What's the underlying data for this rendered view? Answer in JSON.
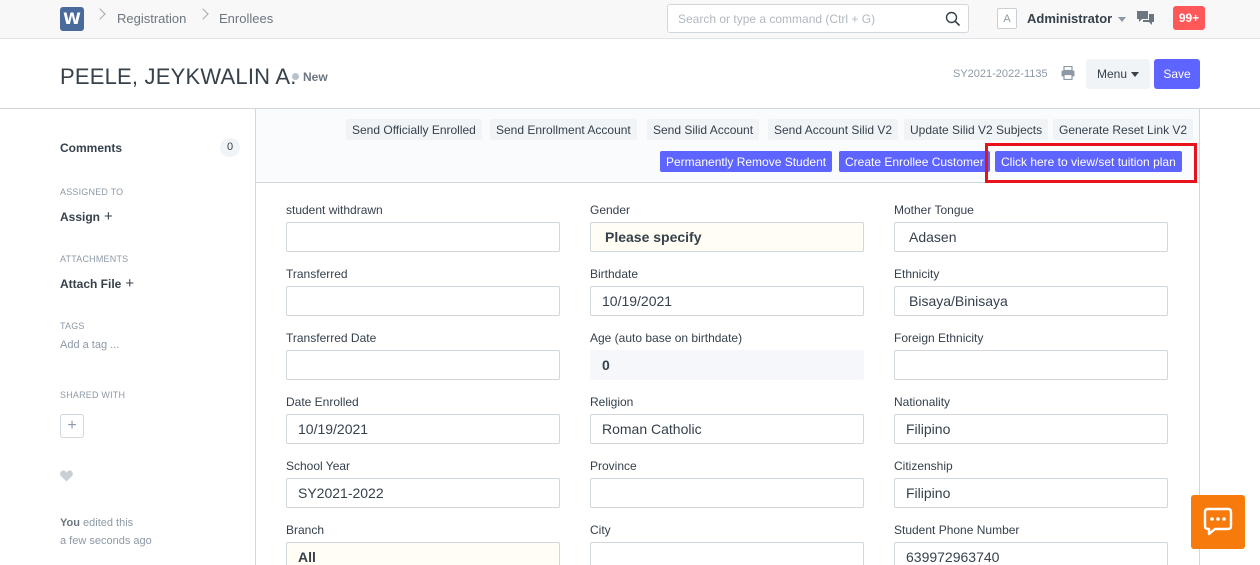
{
  "navbar": {
    "logo": "W",
    "breadcrumbs": [
      "Registration",
      "Enrollees"
    ],
    "search_placeholder": "Search or type a command (Ctrl + G)",
    "avatar_letter": "A",
    "user": "Administrator",
    "notifications": "99+"
  },
  "page": {
    "title": "PEELE, JEYKWALIN A.",
    "status": "New",
    "doc_name": "SY2021-2022-1135",
    "menu_label": "Menu",
    "save_label": "Save"
  },
  "sidebar": {
    "comments_label": "Comments",
    "comments_count": "0",
    "assigned_to_label": "ASSIGNED TO",
    "assign_label": "Assign",
    "attachments_label": "ATTACHMENTS",
    "attach_label": "Attach File",
    "tags_label": "TAGS",
    "add_tag": "Add a tag ...",
    "shared_with_label": "SHARED WITH",
    "edit_user": "You",
    "edit_text": "edited this",
    "edit_time": "a few seconds ago"
  },
  "actions": {
    "row1": [
      "Send Officially Enrolled",
      "Send Enrollment Account",
      "Send Silid Account",
      "Send Account Silid V2",
      "Update Silid V2 Subjects",
      "Generate Reset Link V2"
    ],
    "row2": [
      "Permanently Remove Student",
      "Create Enrollee Customer",
      "Click here to view/set tuition plan"
    ]
  },
  "form": {
    "col1": [
      {
        "label": "student withdrawn",
        "value": ""
      },
      {
        "label": "Transferred",
        "value": ""
      },
      {
        "label": "Transferred Date",
        "value": ""
      },
      {
        "label": "Date Enrolled",
        "value": "10/19/2021"
      },
      {
        "label": "School Year",
        "value": "SY2021-2022"
      },
      {
        "label": "Branch",
        "value": "All"
      }
    ],
    "col2": [
      {
        "label": "Gender",
        "value": "Please specify"
      },
      {
        "label": "Birthdate",
        "value": "10/19/2021"
      },
      {
        "label": "Age (auto base on birthdate)",
        "value": "0"
      },
      {
        "label": "Religion",
        "value": "Roman Catholic"
      },
      {
        "label": "Province",
        "value": ""
      },
      {
        "label": "City",
        "value": ""
      }
    ],
    "col3": [
      {
        "label": "Mother Tongue",
        "value": "Adasen"
      },
      {
        "label": "Ethnicity",
        "value": "Bisaya/Binisaya"
      },
      {
        "label": "Foreign Ethnicity",
        "value": ""
      },
      {
        "label": "Nationality",
        "value": "Filipino"
      },
      {
        "label": "Citizenship",
        "value": "Filipino"
      },
      {
        "label": "Student Phone Number",
        "value": "639972963740"
      }
    ]
  },
  "colors": {
    "primary": "#5e64ff",
    "highlight": "#e8121c",
    "badge": "#ff5858",
    "chat": "#f77a0c"
  }
}
